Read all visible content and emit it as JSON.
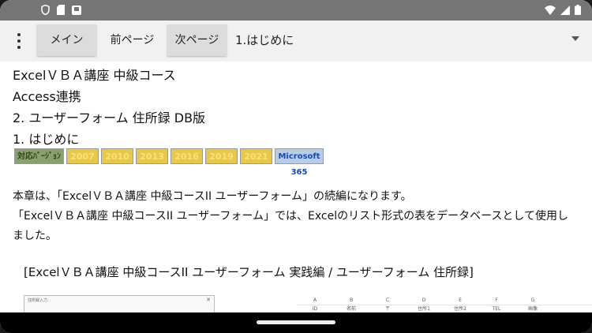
{
  "toolbar": {
    "main_label": "メイン",
    "prev_label": "前ページ",
    "next_label": "次ページ",
    "chapter": "1.はじめに"
  },
  "content": {
    "lines": [
      "ExcelＶＢＡ講座 中級コース",
      "Access連携",
      "2. ユーザーフォーム 住所録 DB版",
      "1. はじめに"
    ],
    "badges": {
      "support": "対応ﾊﾞｰｼﾞｮﾝ",
      "versions": [
        "2007",
        "2010",
        "2013",
        "2016",
        "2019",
        "2021"
      ],
      "ms": "Microsoft 365"
    },
    "paragraph": [
      "本章は、「ExcelＶＢＡ講座 中級コースII ユーザーフォーム」の続編になります。",
      "「ExcelＶＢＡ講座 中級コースII ユーザーフォーム」では、Excelのリスト形式の表をデータベースとして使用し",
      "ました。"
    ],
    "caption": "[ExcelＶＢＡ講座 中級コースII ユーザーフォーム 実践編 / ユーザーフォーム 住所録]"
  },
  "thumbnails": {
    "dialog_title": "住所録入力",
    "sheet_columns": [
      "A",
      "B",
      "C",
      "D",
      "E",
      "F",
      "G"
    ],
    "sheet_headers": [
      "ID",
      "名前",
      "〒",
      "住所1",
      "住所2",
      "TEL",
      "画像"
    ]
  }
}
